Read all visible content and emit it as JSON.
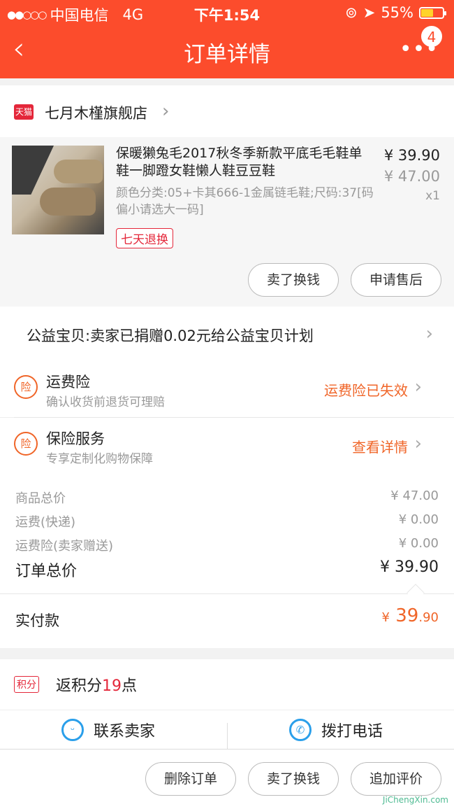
{
  "status_bar": {
    "carrier": "中国电信",
    "network": "4G",
    "time": "下午1:54",
    "battery": "55%",
    "battery_level": 0.55
  },
  "nav": {
    "title": "订单详情",
    "back_icon": "chevron-left-icon",
    "more_icon": "more-dots-icon",
    "badge": "4"
  },
  "shop": {
    "logo_text": "天猫",
    "name": "七月木槿旗舰店"
  },
  "item": {
    "title": "保暖獭兔毛2017秋冬季新款平底毛毛鞋单鞋一脚蹬女鞋懒人鞋豆豆鞋",
    "spec": "颜色分类:05+卡其666-1金属链毛鞋;尺码:37[码偏小请选大一码]",
    "tag": "七天退换",
    "price": "¥ 39.90",
    "original_price": "¥ 47.00",
    "quantity": "x1",
    "btn_sell": "卖了换钱",
    "btn_aftersale": "申请售后"
  },
  "charity": {
    "text": "公益宝贝:卖家已捐赠0.02元给公益宝贝计划"
  },
  "insurance": [
    {
      "icon": "险",
      "title": "运费险",
      "desc": "确认收货前退货可理赔",
      "status": "运费险已失效"
    },
    {
      "icon": "险",
      "title": "保险服务",
      "desc": "专享定制化购物保障",
      "status": "查看详情"
    }
  ],
  "totals": {
    "goods_label": "商品总价",
    "goods_value": "¥ 47.00",
    "ship_label": "运费(快递)",
    "ship_value": "¥ 0.00",
    "ins_label": "运费险(卖家赠送)",
    "ins_value": "¥ 0.00",
    "order_label": "订单总价",
    "order_value": "¥ 39.90"
  },
  "paid": {
    "label": "实付款",
    "currency": "¥",
    "int": "39",
    "dec": ".90"
  },
  "points": {
    "tag": "积分",
    "prefix": "返积分",
    "num": "19",
    "suffix": "点"
  },
  "contact": {
    "seller": "联系卖家",
    "phone": "拨打电话"
  },
  "bottom": {
    "delete": "删除订单",
    "sell": "卖了换钱",
    "review": "追加评价"
  },
  "watermark": "JiChengXin.com"
}
